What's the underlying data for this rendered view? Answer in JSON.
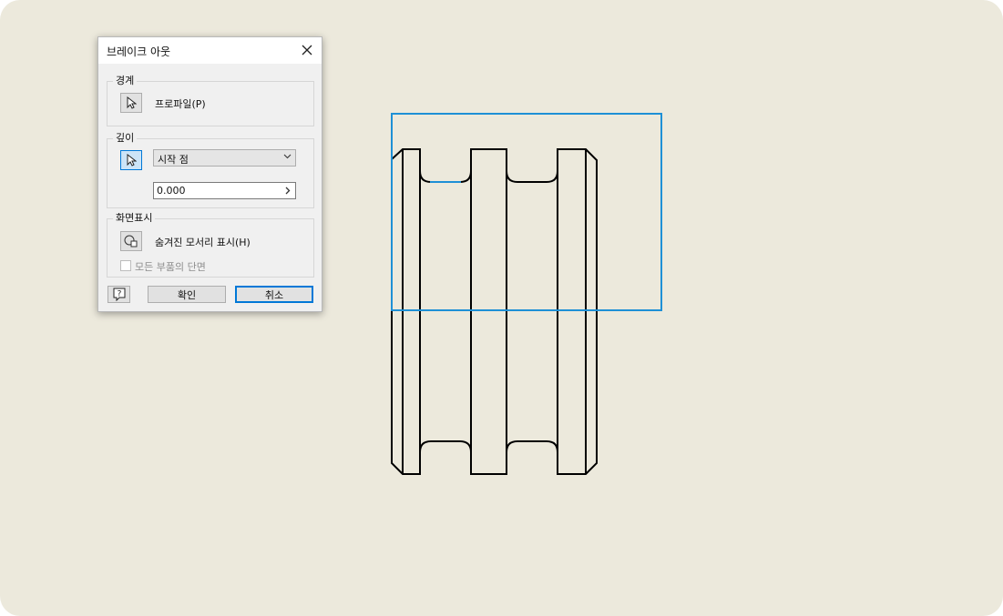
{
  "dialog": {
    "title": "브레이크 아웃",
    "boundary": {
      "label": "경계",
      "profile_label": "프로파일(P)"
    },
    "depth": {
      "label": "깊이",
      "mode_selected": "시작 점",
      "value": "0.000"
    },
    "display": {
      "label": "화면표시",
      "hidden_edges_label": "숨겨진 모서리 표시(H)",
      "all_parts_section_label": "모든 부품의 단면",
      "all_parts_section_checked": false
    },
    "buttons": {
      "ok": "확인",
      "cancel": "취소"
    }
  },
  "icons": {
    "close": "close-icon",
    "cursor": "cursor-arrow-icon",
    "hidden_edges": "hidden-edges-icon",
    "help": "help-icon",
    "chevron": "chevron-down-icon",
    "arrow": "chevron-right-icon"
  },
  "colors": {
    "canvas": "#ece9dc",
    "selection_boundary": "#1e90d6",
    "geometry": "#000000",
    "active_button": "#cce4f7",
    "accent": "#0078d7"
  }
}
